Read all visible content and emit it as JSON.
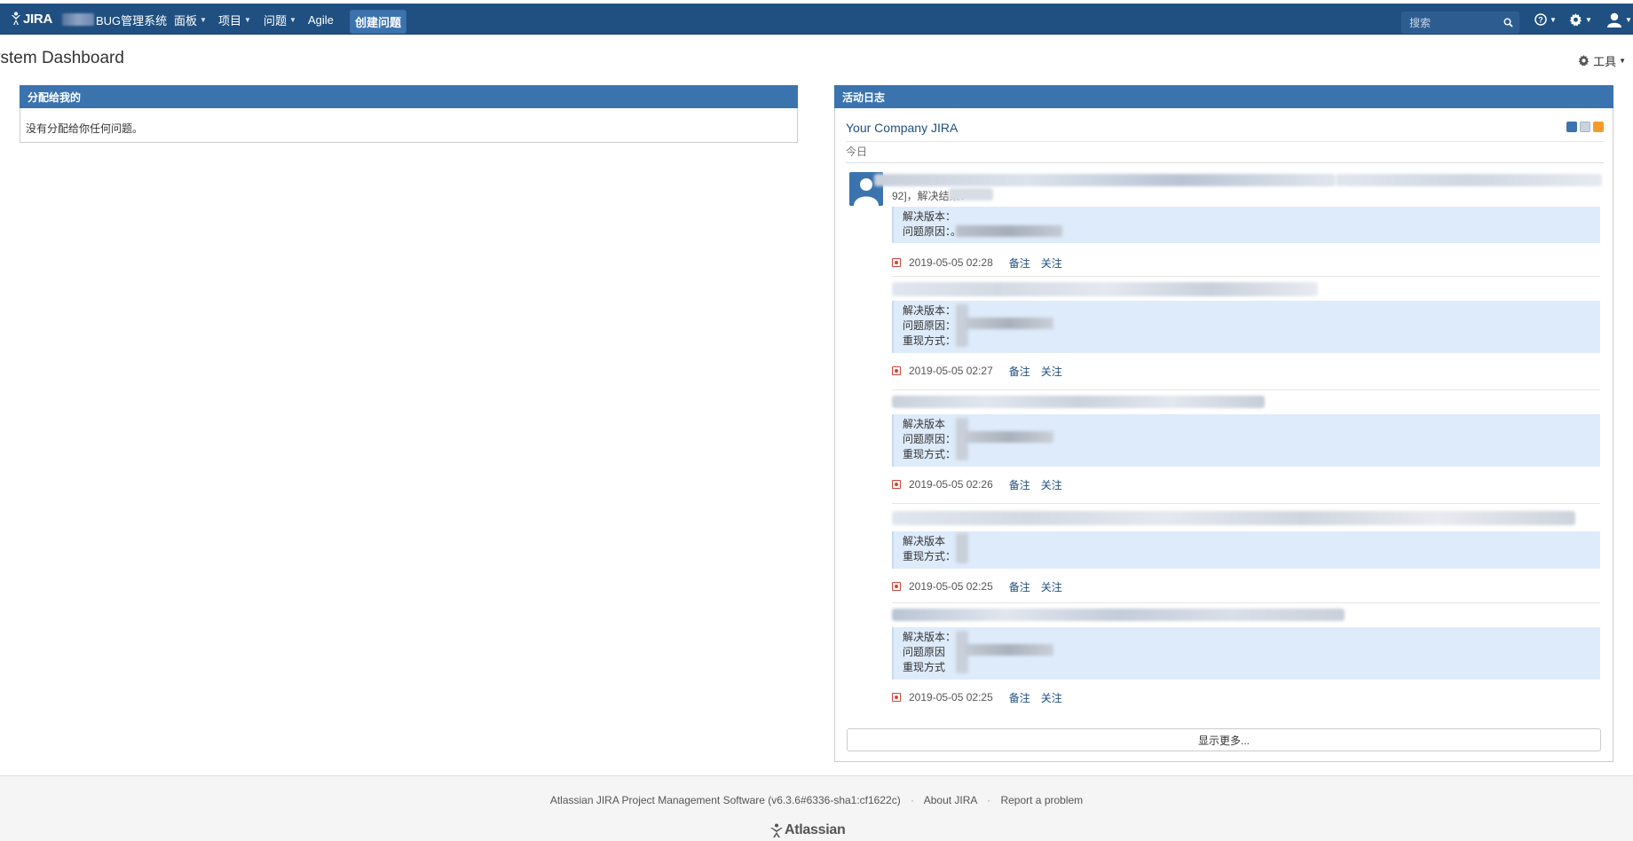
{
  "header": {
    "logo_text": "JIRA",
    "system_name": "BUG管理系统",
    "nav": [
      {
        "label": "面板"
      },
      {
        "label": "项目"
      },
      {
        "label": "问题"
      },
      {
        "label": "Agile"
      }
    ],
    "create_label": "创建问题",
    "search_placeholder": "搜索"
  },
  "page": {
    "title": "ystem Dashboard",
    "tools_label": "工具"
  },
  "assigned_gadget": {
    "title": "分配给我的",
    "empty_message": "没有分配给你任何问题。"
  },
  "activity_gadget": {
    "title": "活动日志",
    "stream_title": "Your Company JIRA",
    "day_label": "今日",
    "first_summary_fragment": "92]，解决结果：",
    "entries": [
      {
        "fields": [
          "解决版本：",
          "问题原因：。"
        ],
        "timestamp": "2019-05-05 02:28",
        "comment_label": "备注",
        "watch_label": "关注"
      },
      {
        "fields": [
          "解决版本：",
          "问题原因：",
          "重现方式："
        ],
        "timestamp": "2019-05-05 02:27",
        "comment_label": "备注",
        "watch_label": "关注"
      },
      {
        "fields": [
          "解决版本",
          "问题原因：",
          "重现方式："
        ],
        "timestamp": "2019-05-05 02:26",
        "comment_label": "备注",
        "watch_label": "关注"
      },
      {
        "fields": [
          "解决版本",
          "重现方式："
        ],
        "timestamp": "2019-05-05 02:25",
        "comment_label": "备注",
        "watch_label": "关注"
      },
      {
        "fields": [
          "解决版本：",
          "问题原因",
          "重现方式"
        ],
        "timestamp": "2019-05-05 02:25",
        "comment_label": "备注",
        "watch_label": "关注"
      }
    ],
    "show_more_label": "显示更多..."
  },
  "footer": {
    "version_text": "Atlassian JIRA Project Management Software (v6.3.6#6336-sha1:cf1622c)",
    "about_label": "About JIRA",
    "report_label": "Report a problem",
    "logo_text": "Atlassian"
  },
  "colors": {
    "header_bg": "#205081",
    "gadget_header_bg": "#3b73af",
    "detail_bg": "#deebfb",
    "link": "#205081",
    "bug_icon": "#d04437"
  }
}
